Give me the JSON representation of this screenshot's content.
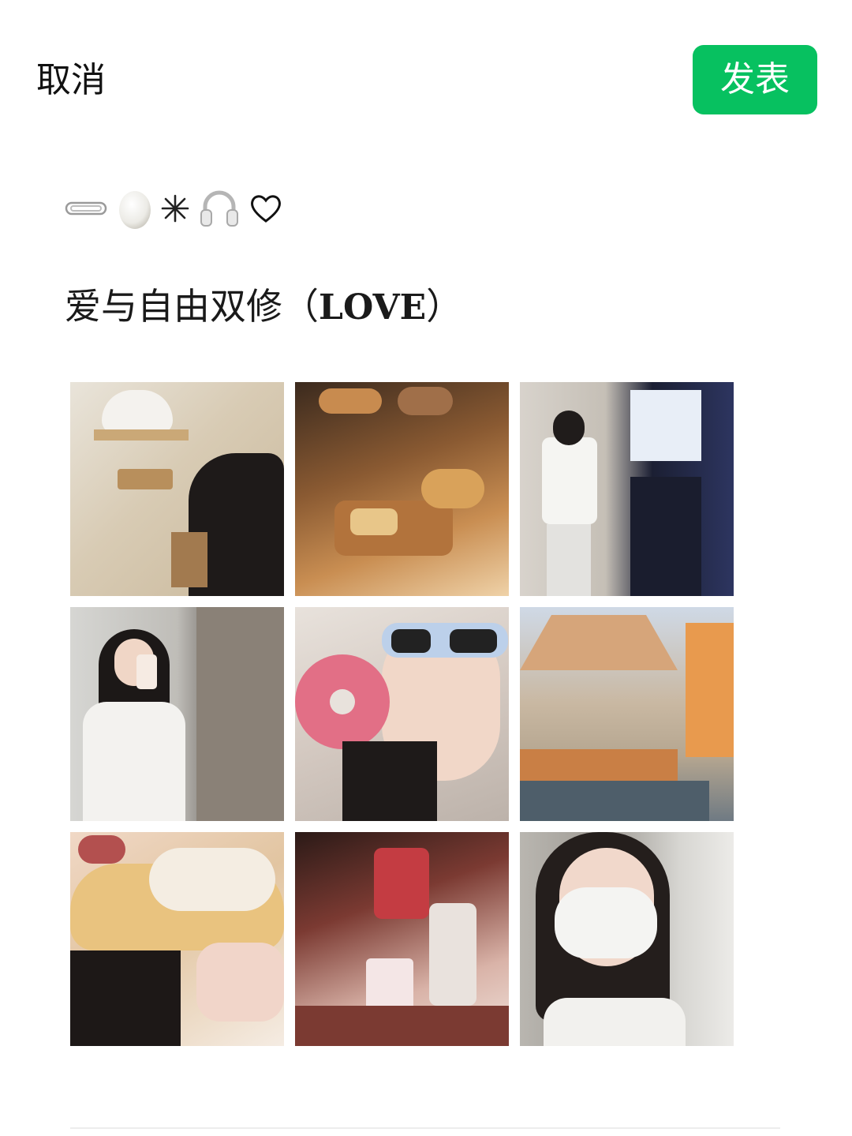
{
  "header": {
    "cancel_label": "取消",
    "publish_label": "发表",
    "publish_color": "#07c160"
  },
  "post": {
    "emoji_icons": [
      "paperclip-icon",
      "egg-icon",
      "sparkle-star-icon",
      "headphones-icon",
      "heart-outline-icon"
    ],
    "emoji_text": "✴ ♡",
    "title_cjk": "爱与自由双修（",
    "title_latin": "LOVE",
    "title_close": "）"
  },
  "photos": [
    {
      "name": "photo-cat-cabinet",
      "description_icon": "photo"
    },
    {
      "name": "photo-bakery-display",
      "description_icon": "photo"
    },
    {
      "name": "photo-girl-in-mall",
      "description_icon": "photo"
    },
    {
      "name": "photo-mirror-selfie",
      "description_icon": "photo"
    },
    {
      "name": "photo-donut-sunglasses",
      "description_icon": "photo"
    },
    {
      "name": "photo-market-stall",
      "description_icon": "photo"
    },
    {
      "name": "photo-eating-donut",
      "description_icon": "photo"
    },
    {
      "name": "photo-tims-cafe",
      "description_icon": "photo"
    },
    {
      "name": "photo-masked-selfie",
      "description_icon": "photo"
    }
  ]
}
